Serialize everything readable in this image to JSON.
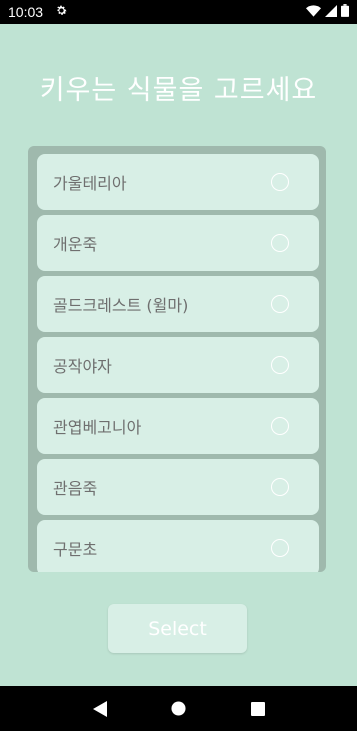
{
  "status_bar": {
    "time": "10:03",
    "icons": [
      "gear-icon",
      "wifi-icon",
      "signal-icon",
      "battery-icon"
    ]
  },
  "title": "키우는 식물을 고르세요",
  "plant_list": {
    "items": [
      {
        "label": "가울테리아"
      },
      {
        "label": "개운죽"
      },
      {
        "label": "골드크레스트 (윌마)"
      },
      {
        "label": "공작야자"
      },
      {
        "label": "관엽베고니아"
      },
      {
        "label": "관음죽"
      },
      {
        "label": "구문초"
      }
    ]
  },
  "select_button": {
    "label": "Select"
  },
  "nav_bar": {
    "icons": [
      "back-icon",
      "home-icon",
      "recents-icon"
    ]
  },
  "colors": {
    "background": "#bfe3d3",
    "panel": "#9fb9ad",
    "item": "#d8efe6",
    "text": "#6f6f6f"
  }
}
